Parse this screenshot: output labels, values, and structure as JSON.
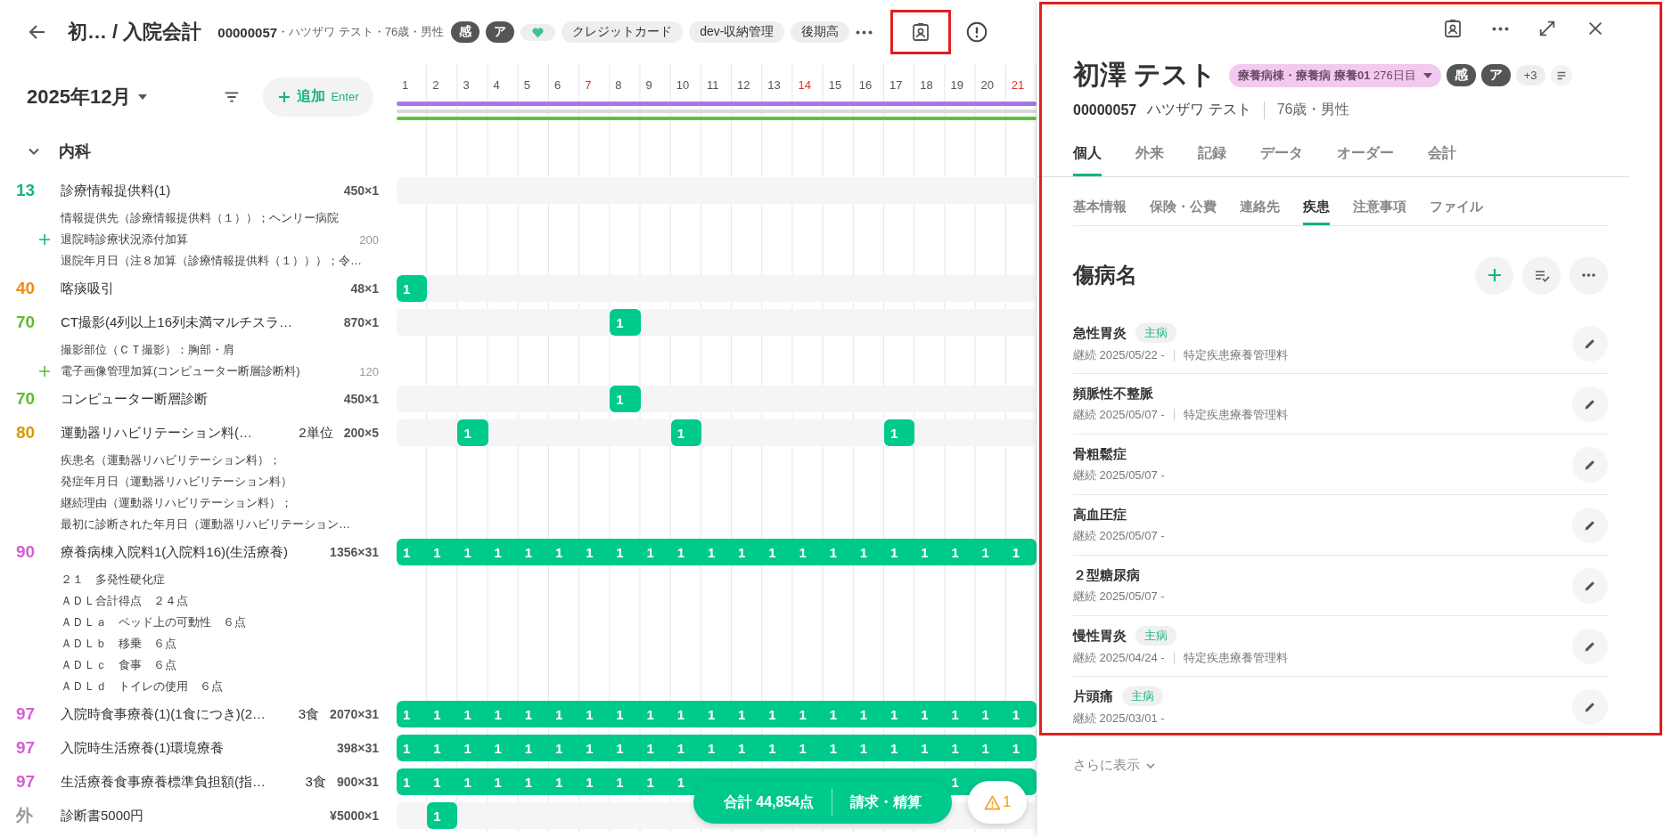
{
  "header": {
    "title": "初… / 入院会計",
    "patient_id": "00000057",
    "patient_info": "・ハツザワ テスト・76歳・男性",
    "tags": [
      {
        "kind": "dark",
        "label": "感"
      },
      {
        "kind": "dark",
        "label": "ア"
      },
      {
        "kind": "heart"
      },
      {
        "kind": "chip",
        "label": "クレジットカード"
      },
      {
        "kind": "chip",
        "label": "dev-収納管理"
      },
      {
        "kind": "chip",
        "label": "後期高"
      }
    ],
    "contact_button": {
      "highlighted": true
    }
  },
  "toolbar": {
    "month": "2025年12月",
    "add_label": "追加",
    "add_shortcut": "Enter"
  },
  "calendar": {
    "days": [
      {
        "label": "1",
        "sunday": false
      },
      {
        "label": "2",
        "sunday": false
      },
      {
        "label": "3",
        "sunday": false
      },
      {
        "label": "4",
        "sunday": false
      },
      {
        "label": "5",
        "sunday": false
      },
      {
        "label": "6",
        "sunday": false
      },
      {
        "label": "7",
        "sunday": true
      },
      {
        "label": "8",
        "sunday": false
      },
      {
        "label": "9",
        "sunday": false
      },
      {
        "label": "10",
        "sunday": false
      },
      {
        "label": "11",
        "sunday": false
      },
      {
        "label": "12",
        "sunday": false
      },
      {
        "label": "13",
        "sunday": false
      },
      {
        "label": "14",
        "sunday": true
      },
      {
        "label": "15",
        "sunday": false
      },
      {
        "label": "16",
        "sunday": false
      },
      {
        "label": "17",
        "sunday": false
      },
      {
        "label": "18",
        "sunday": false
      },
      {
        "label": "19",
        "sunday": false
      },
      {
        "label": "20",
        "sunday": false
      },
      {
        "label": "21",
        "sunday": true
      }
    ]
  },
  "group": {
    "label": "内科",
    "expanded": true
  },
  "items": [
    {
      "code": "13",
      "color": "#16b57f",
      "name": "診療情報提供料(1)",
      "amount": "450×1",
      "days": [
        {
          "on": false
        },
        {
          "on": false
        },
        {
          "on": false
        },
        {
          "on": false
        },
        {
          "on": false
        },
        {
          "on": false
        },
        {
          "on": false
        },
        {
          "on": false
        },
        {
          "on": false
        },
        {
          "on": false
        },
        {
          "on": false
        },
        {
          "on": false
        },
        {
          "on": false
        },
        {
          "on": false
        },
        {
          "on": false
        },
        {
          "on": false
        },
        {
          "on": false
        },
        {
          "on": false
        },
        {
          "on": false
        },
        {
          "on": false
        },
        {
          "on": false
        }
      ],
      "notes": [
        {
          "kind": "note",
          "text": "情報提供先（診療情報提供料（１））；ヘンリー病院"
        },
        {
          "kind": "addition",
          "text": "退院時診療状況添付加算",
          "amount": "200"
        },
        {
          "kind": "note",
          "text": "退院年月日（注８加算（診療情報提供料（１）））；令…"
        }
      ]
    },
    {
      "code": "40",
      "color": "#f08a12",
      "name": "喀痰吸引",
      "amount": "48×1",
      "days": [
        {
          "on": true,
          "count": "1"
        },
        {
          "on": false
        },
        {
          "on": false
        },
        {
          "on": false
        },
        {
          "on": false
        },
        {
          "on": false
        },
        {
          "on": false
        },
        {
          "on": false
        },
        {
          "on": false
        },
        {
          "on": false
        },
        {
          "on": false
        },
        {
          "on": false
        },
        {
          "on": false
        },
        {
          "on": false
        },
        {
          "on": false
        },
        {
          "on": false
        },
        {
          "on": false
        },
        {
          "on": false
        },
        {
          "on": false
        },
        {
          "on": false
        },
        {
          "on": false
        }
      ]
    },
    {
      "code": "70",
      "color": "#5cbd2c",
      "name": "CT撮影(4列以上16列未満マルチスラ…",
      "amount": "870×1",
      "days": [
        {
          "on": false
        },
        {
          "on": false
        },
        {
          "on": false
        },
        {
          "on": false
        },
        {
          "on": false
        },
        {
          "on": false
        },
        {
          "on": false
        },
        {
          "on": true,
          "count": "1"
        },
        {
          "on": false
        },
        {
          "on": false
        },
        {
          "on": false
        },
        {
          "on": false
        },
        {
          "on": false
        },
        {
          "on": false
        },
        {
          "on": false
        },
        {
          "on": false
        },
        {
          "on": false
        },
        {
          "on": false
        },
        {
          "on": false
        },
        {
          "on": false
        },
        {
          "on": false
        }
      ],
      "notes": [
        {
          "kind": "note",
          "text": "撮影部位（ＣＴ撮影）：胸部・肩"
        },
        {
          "kind": "addition",
          "text": "電子画像管理加算(コンピューター断層診断料)",
          "amount": "120"
        }
      ]
    },
    {
      "code": "70",
      "color": "#5cbd2c",
      "name": "コンピューター断層診断",
      "amount": "450×1",
      "days": [
        {
          "on": false
        },
        {
          "on": false
        },
        {
          "on": false
        },
        {
          "on": false
        },
        {
          "on": false
        },
        {
          "on": false
        },
        {
          "on": false
        },
        {
          "on": true,
          "count": "1"
        },
        {
          "on": false
        },
        {
          "on": false
        },
        {
          "on": false
        },
        {
          "on": false
        },
        {
          "on": false
        },
        {
          "on": false
        },
        {
          "on": false
        },
        {
          "on": false
        },
        {
          "on": false
        },
        {
          "on": false
        },
        {
          "on": false
        },
        {
          "on": false
        },
        {
          "on": false
        }
      ]
    },
    {
      "code": "80",
      "color": "#d69a00",
      "name": "運動器リハビリテーション料(…",
      "unit": "2単位",
      "amount": "200×5",
      "days": [
        {
          "on": false
        },
        {
          "on": false
        },
        {
          "on": true,
          "count": "1"
        },
        {
          "on": false
        },
        {
          "on": false
        },
        {
          "on": false
        },
        {
          "on": false
        },
        {
          "on": false
        },
        {
          "on": false
        },
        {
          "on": true,
          "count": "1"
        },
        {
          "on": false
        },
        {
          "on": false
        },
        {
          "on": false
        },
        {
          "on": false
        },
        {
          "on": false
        },
        {
          "on": false
        },
        {
          "on": true,
          "count": "1"
        },
        {
          "on": false
        },
        {
          "on": false
        },
        {
          "on": false
        },
        {
          "on": false
        }
      ],
      "notes": [
        {
          "kind": "note",
          "text": "疾患名（運動器リハビリテーション料）；"
        },
        {
          "kind": "note",
          "text": "発症年月日（運動器リハビリテーション料）"
        },
        {
          "kind": "note",
          "text": "継続理由（運動器リハビリテーション料）；"
        },
        {
          "kind": "note",
          "text": "最初に診断された年月日（運動器リハビリテーション…"
        }
      ]
    },
    {
      "code": "90",
      "color": "#d55ed6",
      "name": "療養病棟入院料1(入院料16)(生活療養)",
      "amount": "1356×31",
      "days": [
        {
          "on": true,
          "count": "1"
        },
        {
          "on": true,
          "count": "1"
        },
        {
          "on": true,
          "count": "1"
        },
        {
          "on": true,
          "count": "1"
        },
        {
          "on": true,
          "count": "1"
        },
        {
          "on": true,
          "count": "1"
        },
        {
          "on": true,
          "count": "1"
        },
        {
          "on": true,
          "count": "1"
        },
        {
          "on": true,
          "count": "1"
        },
        {
          "on": true,
          "count": "1"
        },
        {
          "on": true,
          "count": "1"
        },
        {
          "on": true,
          "count": "1"
        },
        {
          "on": true,
          "count": "1"
        },
        {
          "on": true,
          "count": "1"
        },
        {
          "on": true,
          "count": "1"
        },
        {
          "on": true,
          "count": "1"
        },
        {
          "on": true,
          "count": "1"
        },
        {
          "on": true,
          "count": "1"
        },
        {
          "on": true,
          "count": "1"
        },
        {
          "on": true,
          "count": "1"
        },
        {
          "on": true,
          "count": "1"
        }
      ],
      "notes": [
        {
          "kind": "note",
          "text": "２１　多発性硬化症"
        },
        {
          "kind": "note",
          "text": "ＡＤＬ合計得点　２４点"
        },
        {
          "kind": "note",
          "text": "ＡＤＬａ　ベッド上の可動性　６点"
        },
        {
          "kind": "note",
          "text": "ＡＤＬｂ　移乗　６点"
        },
        {
          "kind": "note",
          "text": "ＡＤＬｃ　食事　６点"
        },
        {
          "kind": "note",
          "text": "ＡＤＬｄ　トイレの使用　６点"
        }
      ]
    },
    {
      "code": "97",
      "color": "#d55ed6",
      "name": "入院時食事療養(1)(1食につき)(2…",
      "unit": "3食",
      "amount": "2070×31",
      "days": [
        {
          "on": true,
          "count": "1"
        },
        {
          "on": true,
          "count": "1"
        },
        {
          "on": true,
          "count": "1"
        },
        {
          "on": true,
          "count": "1"
        },
        {
          "on": true,
          "count": "1"
        },
        {
          "on": true,
          "count": "1"
        },
        {
          "on": true,
          "count": "1"
        },
        {
          "on": true,
          "count": "1"
        },
        {
          "on": true,
          "count": "1"
        },
        {
          "on": true,
          "count": "1"
        },
        {
          "on": true,
          "count": "1"
        },
        {
          "on": true,
          "count": "1"
        },
        {
          "on": true,
          "count": "1"
        },
        {
          "on": true,
          "count": "1"
        },
        {
          "on": true,
          "count": "1"
        },
        {
          "on": true,
          "count": "1"
        },
        {
          "on": true,
          "count": "1"
        },
        {
          "on": true,
          "count": "1"
        },
        {
          "on": true,
          "count": "1"
        },
        {
          "on": true,
          "count": "1"
        },
        {
          "on": true,
          "count": "1"
        }
      ]
    },
    {
      "code": "97",
      "color": "#d55ed6",
      "name": "入院時生活療養(1)環境療養",
      "amount": "398×31",
      "days": [
        {
          "on": true,
          "count": "1"
        },
        {
          "on": true,
          "count": "1"
        },
        {
          "on": true,
          "count": "1"
        },
        {
          "on": true,
          "count": "1"
        },
        {
          "on": true,
          "count": "1"
        },
        {
          "on": true,
          "count": "1"
        },
        {
          "on": true,
          "count": "1"
        },
        {
          "on": true,
          "count": "1"
        },
        {
          "on": true,
          "count": "1"
        },
        {
          "on": true,
          "count": "1"
        },
        {
          "on": true,
          "count": "1"
        },
        {
          "on": true,
          "count": "1"
        },
        {
          "on": true,
          "count": "1"
        },
        {
          "on": true,
          "count": "1"
        },
        {
          "on": true,
          "count": "1"
        },
        {
          "on": true,
          "count": "1"
        },
        {
          "on": true,
          "count": "1"
        },
        {
          "on": true,
          "count": "1"
        },
        {
          "on": true,
          "count": "1"
        },
        {
          "on": true,
          "count": "1"
        },
        {
          "on": true,
          "count": "1"
        }
      ]
    },
    {
      "code": "97",
      "color": "#d55ed6",
      "name": "生活療養食事療養標準負担額(指…",
      "unit": "3食",
      "amount": "900×31",
      "days": [
        {
          "on": true,
          "count": "1"
        },
        {
          "on": true,
          "count": "1"
        },
        {
          "on": true,
          "count": "1"
        },
        {
          "on": true,
          "count": "1"
        },
        {
          "on": true,
          "count": "1"
        },
        {
          "on": true,
          "count": "1"
        },
        {
          "on": true,
          "count": "1"
        },
        {
          "on": true,
          "count": "1"
        },
        {
          "on": true,
          "count": "1"
        },
        {
          "on": true,
          "count": "1"
        },
        {
          "on": true
        },
        {
          "on": true
        },
        {
          "on": true
        },
        {
          "on": true
        },
        {
          "on": true
        },
        {
          "on": true
        },
        {
          "on": true
        },
        {
          "on": true
        },
        {
          "on": true,
          "count": "1"
        },
        {
          "on": true
        },
        {
          "on": true
        }
      ]
    },
    {
      "code": "外",
      "color": "#9a9a9a",
      "name": "診断書5000円",
      "amount": "¥5000×1",
      "days": [
        {
          "on": false
        },
        {
          "on": true,
          "count": "1"
        },
        {
          "on": false
        },
        {
          "on": false
        },
        {
          "on": false
        },
        {
          "on": false
        },
        {
          "on": false
        },
        {
          "on": false
        },
        {
          "on": false
        },
        {
          "on": false
        },
        {
          "on": false
        },
        {
          "on": false
        },
        {
          "on": false
        },
        {
          "on": false
        },
        {
          "on": false
        },
        {
          "on": false
        },
        {
          "on": false
        },
        {
          "on": false
        },
        {
          "on": false
        },
        {
          "on": false
        },
        {
          "on": false
        }
      ]
    }
  ],
  "footer": {
    "total": "合計 44,854点",
    "bill": "請求・精算",
    "alerts": "1"
  },
  "panel": {
    "highlighted": true,
    "name": "初澤 テスト",
    "ward": "**療養病棟・療養病 療養01** 276日目",
    "badges": [
      "感",
      "ア"
    ],
    "more_badges": "+3",
    "patient_id": "00000057",
    "kana": "ハツザワ テスト",
    "age_sex": "76歳・男性",
    "tabs": [
      {
        "label": "個人",
        "selected": true
      },
      {
        "label": "外来",
        "selected": false
      },
      {
        "label": "記録",
        "selected": false
      },
      {
        "label": "データ",
        "selected": false
      },
      {
        "label": "オーダー",
        "selected": false
      },
      {
        "label": "会計",
        "selected": false
      }
    ],
    "subtabs": [
      {
        "label": "基本情報",
        "selected": false
      },
      {
        "label": "保険・公費",
        "selected": false
      },
      {
        "label": "連絡先",
        "selected": false
      },
      {
        "label": "疾患",
        "selected": true
      },
      {
        "label": "注意事項",
        "selected": false
      },
      {
        "label": "ファイル",
        "selected": false
      }
    ],
    "section_title": "傷病名",
    "diseases": [
      {
        "name": "急性胃炎",
        "tag": "主病",
        "since": "継続 2025/05/22 -",
        "note": "特定疾患療養管理料"
      },
      {
        "name": "頻脈性不整脈",
        "since": "継続 2025/05/07 -",
        "note": "特定疾患療養管理料"
      },
      {
        "name": "骨粗鬆症",
        "since": "継続 2025/05/07 -"
      },
      {
        "name": "高血圧症",
        "since": "継続 2025/05/07 -"
      },
      {
        "name": "２型糖尿病",
        "since": "継続 2025/05/07 -"
      },
      {
        "name": "慢性胃炎",
        "tag": "主病",
        "since": "継続 2025/04/24 -",
        "note": "特定疾患療養管理料"
      },
      {
        "name": "片頭痛",
        "tag": "主病",
        "since": "継続 2025/03/01 -"
      }
    ],
    "show_more": "さらに表示"
  }
}
